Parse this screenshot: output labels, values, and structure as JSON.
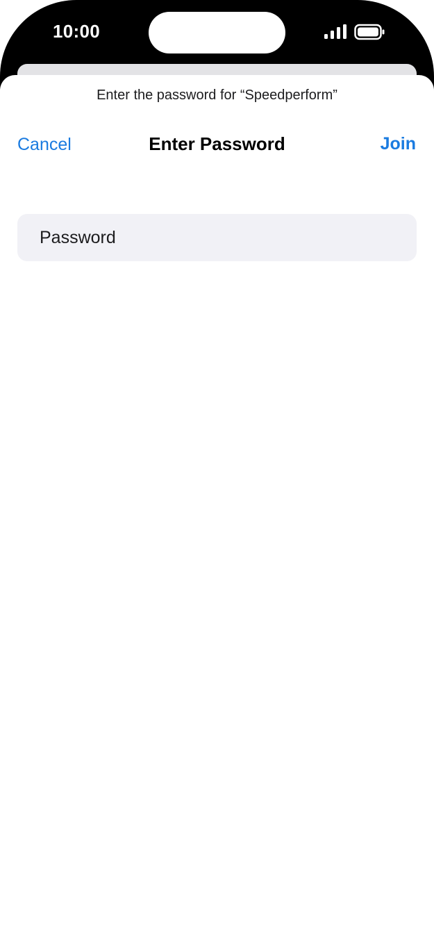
{
  "status_bar": {
    "time": "10:00",
    "signal_icon": "cellular-signal-icon",
    "battery_icon": "battery-icon"
  },
  "sheet": {
    "prompt": "Enter the password for “Speedperform”",
    "nav": {
      "cancel_label": "Cancel",
      "title": "Enter Password",
      "join_label": "Join"
    },
    "password_field": {
      "placeholder": "Password",
      "value": ""
    }
  },
  "colors": {
    "accent": "#1a7be0",
    "field_background": "#f1f1f6",
    "status_bar_background": "#000000"
  }
}
